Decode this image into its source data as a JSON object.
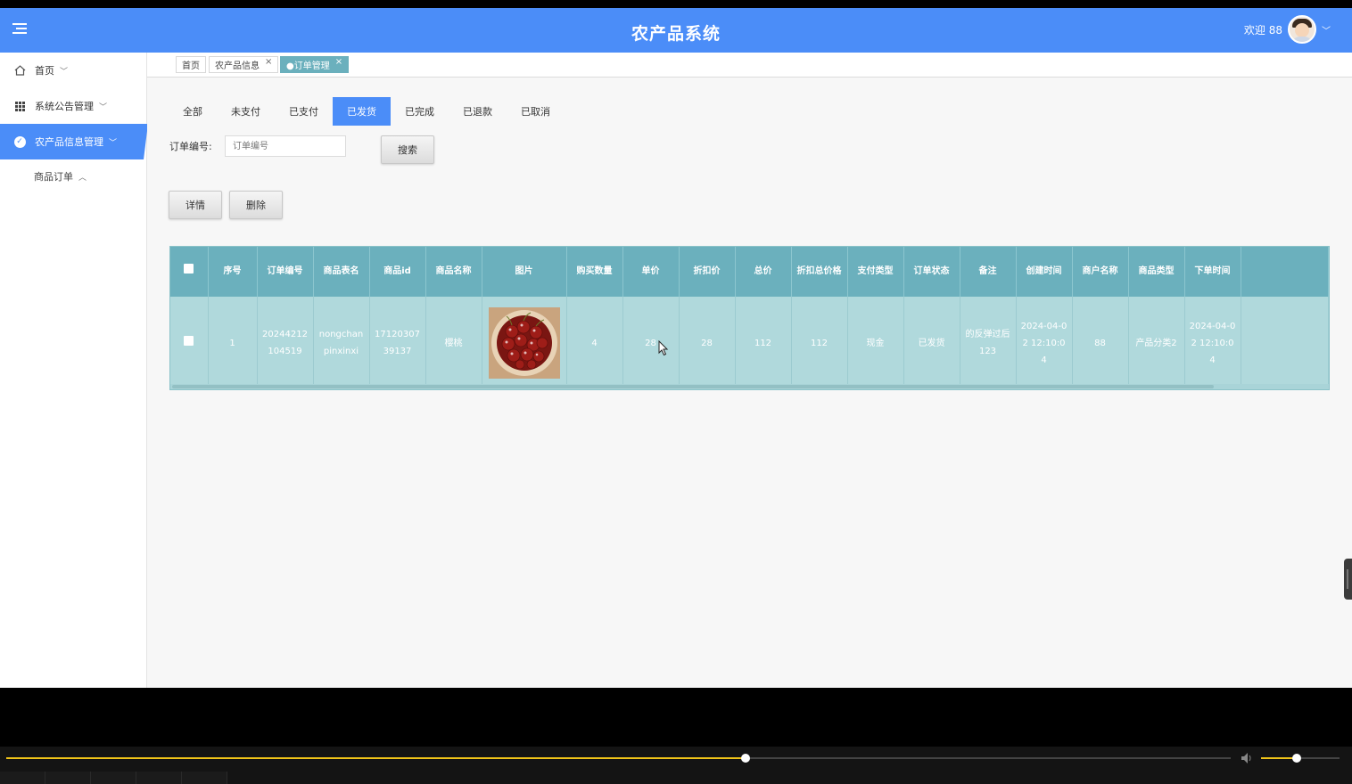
{
  "header": {
    "title": "农产品系统",
    "welcome": "欢迎 88"
  },
  "sidebar": {
    "items": [
      {
        "label": "首页",
        "icon": "home-icon",
        "arrow": "﹀"
      },
      {
        "label": "系统公告管理",
        "icon": "grid-icon",
        "arrow": "﹀"
      },
      {
        "label": "农产品信息管理",
        "icon": "check-circle-icon",
        "arrow": "﹀",
        "active": true
      }
    ],
    "sub_items": [
      {
        "label": "商品订单",
        "arrow": "︿"
      }
    ]
  },
  "tabs": [
    {
      "label": "首页",
      "closable": false
    },
    {
      "label": "农产品信息",
      "closable": true
    },
    {
      "label": "●订单管理",
      "closable": true,
      "active": true
    }
  ],
  "status_tabs": [
    "全部",
    "未支付",
    "已支付",
    "已发货",
    "已完成",
    "已退款",
    "已取消"
  ],
  "status_active": "已发货",
  "search": {
    "label": "订单编号:",
    "placeholder": "订单编号",
    "button": "搜索"
  },
  "actions": {
    "detail": "详情",
    "delete": "删除"
  },
  "table": {
    "headers": [
      "序号",
      "订单编号",
      "商品表名",
      "商品id",
      "商品名称",
      "图片",
      "购买数量",
      "单价",
      "折扣价",
      "总价",
      "折扣总价格",
      "支付类型",
      "订单状态",
      "备注",
      "创建时间",
      "商户名称",
      "商品类型",
      "下单时间"
    ],
    "rows": [
      {
        "index": "1",
        "order_no": "20244212104519",
        "table_name": "nongchanpinxinxi",
        "product_id": "1712030739137",
        "product_name": "樱桃",
        "image": "cherries",
        "quantity": "4",
        "price": "28",
        "discount_price": "28",
        "total": "112",
        "discount_total": "112",
        "pay_type": "现金",
        "status": "已发货",
        "remark": "的反弹过后123",
        "created": "2024-04-02 12:10:04",
        "merchant": "88",
        "category": "产品分类2",
        "order_time": "2024-04-02 12:10:04"
      }
    ]
  },
  "player": {
    "progress": 0.604,
    "volume": 0.45
  },
  "colors": {
    "primary": "#4b8df8",
    "table_header": "#6bb0bd",
    "table_row": "#b0d9dc",
    "progress": "#f0c419"
  }
}
